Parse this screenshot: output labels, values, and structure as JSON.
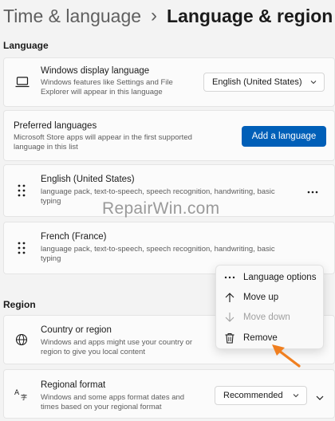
{
  "header": {
    "parent": "Time & language",
    "separator": "›",
    "current": "Language & region"
  },
  "language_section": {
    "label": "Language"
  },
  "display_language": {
    "title": "Windows display language",
    "desc_line1": "Windows features like Settings and File",
    "desc_line2": "Explorer will appear in this language",
    "selected": "English (United States)",
    "icon": "laptop-icon"
  },
  "preferred_languages": {
    "title": "Preferred languages",
    "desc_line1": "Microsoft Store apps will appear in the first supported",
    "desc_line2": "language in this list",
    "button": "Add a language"
  },
  "languages": [
    {
      "name": "English (United States)",
      "desc_line1": "language pack, text-to-speech, speech recognition, handwriting, basic",
      "desc_line2": "typing"
    },
    {
      "name": "French (France)",
      "desc_line1": "language pack, text-to-speech, speech recognition, handwriting, basic",
      "desc_line2": "typing"
    }
  ],
  "context_menu": {
    "items": [
      {
        "label": "Language options",
        "icon": "more-icon",
        "enabled": true
      },
      {
        "label": "Move up",
        "icon": "arrow-up-icon",
        "enabled": true
      },
      {
        "label": "Move down",
        "icon": "arrow-down-icon",
        "enabled": false
      },
      {
        "label": "Remove",
        "icon": "trash-icon",
        "enabled": true
      }
    ]
  },
  "region_section": {
    "label": "Region"
  },
  "country": {
    "title": "Country or region",
    "desc_line1": "Windows and apps might use your country or",
    "desc_line2": "region to give you local content",
    "icon": "globe-icon"
  },
  "regional_format": {
    "title": "Regional format",
    "desc_line1": "Windows and some apps format dates and",
    "desc_line2": "times based on your regional format",
    "selected": "Recommended",
    "icon": "language-format-icon"
  },
  "watermark": "RepairWin.com",
  "colors": {
    "accent": "#005fb8",
    "annotation_arrow": "#f07f1f"
  }
}
